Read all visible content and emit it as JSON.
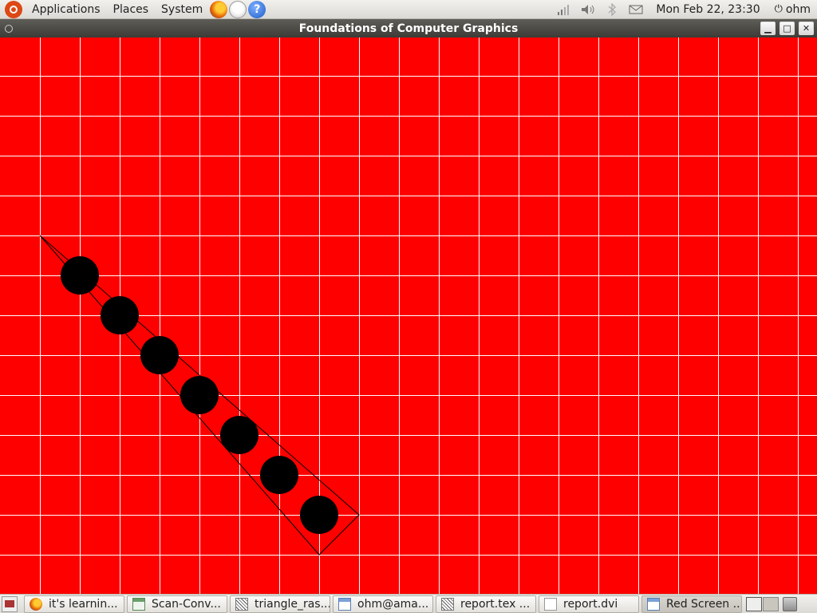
{
  "top_panel": {
    "menus": [
      "Applications",
      "Places",
      "System"
    ],
    "clock": "Mon Feb 22, 23:30",
    "user": "ohm",
    "launchers": [
      "firefox-icon",
      "mail-icon",
      "help-icon"
    ],
    "help_glyph": "?",
    "tray_icons": [
      "network-icon",
      "volume-icon",
      "bluetooth-icon",
      "mail-envelope-icon"
    ]
  },
  "window": {
    "title": "Foundations of Computer Graphics",
    "controls": [
      "minimize",
      "maximize",
      "close"
    ]
  },
  "canvas": {
    "background_color": "#ff0000",
    "grid_color": "#ffffff",
    "dot_color": "#000000",
    "outline_color": "#000000",
    "grid": {
      "cols": 20,
      "rows": 14
    },
    "triangle_cells": [
      [
        1,
        5
      ],
      [
        9,
        12
      ],
      [
        8,
        13
      ]
    ],
    "filled_cells": [
      [
        2,
        6
      ],
      [
        3,
        7
      ],
      [
        4,
        8
      ],
      [
        5,
        9
      ],
      [
        6,
        10
      ],
      [
        7,
        11
      ],
      [
        8,
        12
      ]
    ]
  },
  "taskbar": {
    "tasks": [
      {
        "label": "it's learnin...",
        "icon": "firefox-icon"
      },
      {
        "label": "Scan-Conv...",
        "icon": "image-viewer-icon"
      },
      {
        "label": "triangle_ras...",
        "icon": "text-editor-icon"
      },
      {
        "label": "ohm@ama...",
        "icon": "terminal-window-icon"
      },
      {
        "label": "report.tex ...",
        "icon": "text-editor-icon"
      },
      {
        "label": "report.dvi",
        "icon": "document-icon"
      },
      {
        "label": "Red Screen ...",
        "icon": "window-icon",
        "active": true
      }
    ],
    "workspaces": 2
  }
}
